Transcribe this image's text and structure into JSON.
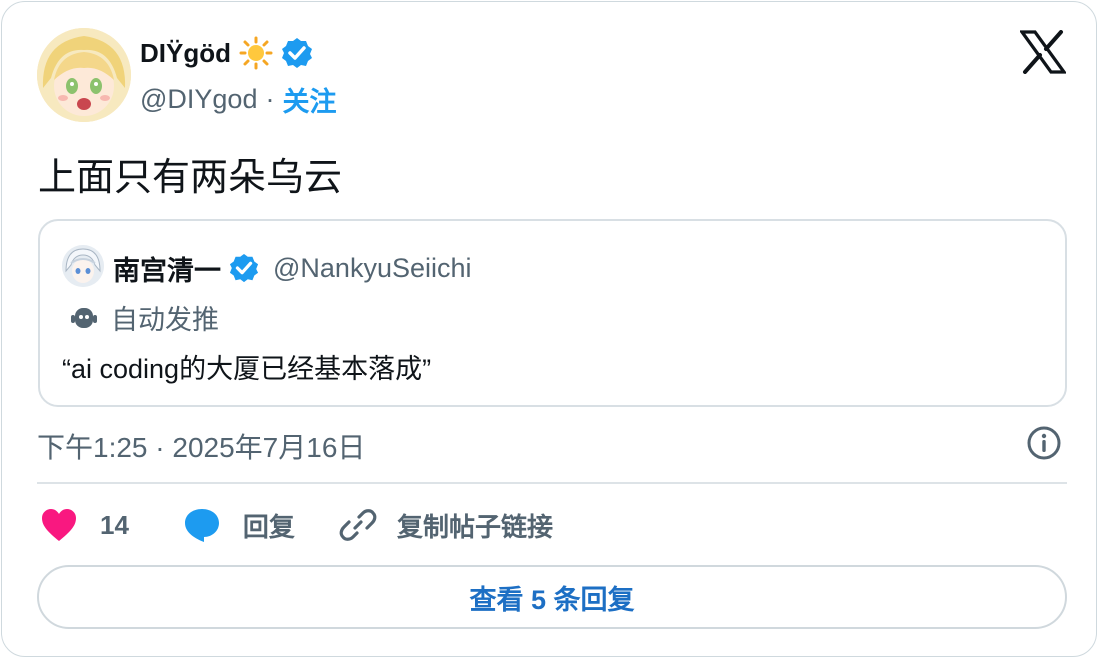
{
  "author": {
    "display_name": "DIŸgöd",
    "handle": "@DIYgod",
    "separator": "·",
    "follow_label": "关注"
  },
  "tweet": {
    "text": "上面只有两朵乌云",
    "timestamp": "下午1:25 · 2025年7月16日"
  },
  "quoted_tweet": {
    "display_name": "南宫清一",
    "handle": "@NankyuSeiichi",
    "automated_label": "自动发推",
    "text": "“ai coding的大厦已经基本落成”"
  },
  "actions": {
    "like_count": "14",
    "reply_label": "回复",
    "copy_link_label": "复制帖子链接"
  },
  "view_replies_label": "查看 5 条回复",
  "colors": {
    "accent_blue": "#1d9bf0",
    "like_pink": "#f91880",
    "reply_blue": "#1d9bf0",
    "secondary_text": "#536471",
    "border": "#cfd9de"
  },
  "icons": [
    "sun-icon",
    "verified-icon",
    "x-logo-icon",
    "robot-icon",
    "info-icon",
    "heart-icon",
    "reply-bubble-icon",
    "link-icon"
  ]
}
